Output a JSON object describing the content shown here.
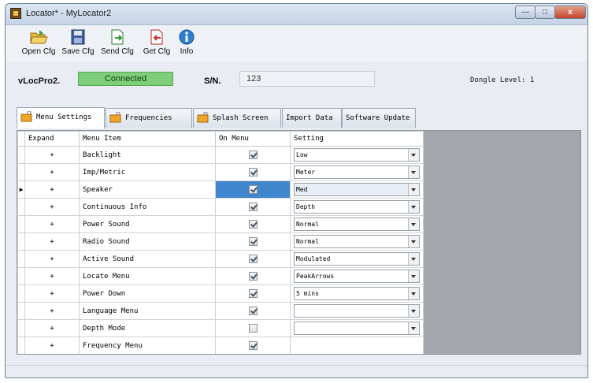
{
  "window": {
    "title": "Locator* - MyLocator2",
    "controls": [
      "minimize",
      "maximize",
      "close"
    ],
    "close_glyph": "x"
  },
  "toolbar": {
    "buttons": [
      {
        "label": "Open Cfg",
        "icon": "folder-open-icon"
      },
      {
        "label": "Save Cfg",
        "icon": "save-disk-icon"
      },
      {
        "label": "Send Cfg",
        "icon": "send-document-icon"
      },
      {
        "label": "Get Cfg",
        "icon": "get-document-icon"
      },
      {
        "label": "Info",
        "icon": "info-icon"
      }
    ]
  },
  "status": {
    "device": "vLocPro2.",
    "connection": "Connected",
    "connection_color": "#7fcf7a",
    "sn_label": "S/N.",
    "sn_value": "123",
    "dongle_level": "Dongle Level: 1"
  },
  "tabs": [
    {
      "label": "Menu Settings",
      "active": true,
      "icon": "lock-folder-icon"
    },
    {
      "label": "Frequencies",
      "active": false,
      "icon": "lock-folder-icon"
    },
    {
      "label": "Splash Screen",
      "active": false,
      "icon": "lock-folder-icon"
    },
    {
      "label": "Import Data",
      "active": false
    },
    {
      "label": "Software Update",
      "active": false
    }
  ],
  "grid": {
    "columns": [
      "Expand",
      "Menu Item",
      "On Menu",
      "Setting"
    ],
    "selection_color": "#3f86cc",
    "rows": [
      {
        "expand": "+",
        "item": "Backlight",
        "on": true,
        "setting": "Low",
        "has_dropdown": true
      },
      {
        "expand": "+",
        "item": "Imp/Metric",
        "on": true,
        "setting": "Meter",
        "has_dropdown": true
      },
      {
        "expand": "+",
        "item": "Speaker",
        "on": true,
        "setting": "Med",
        "has_dropdown": true,
        "selected": true
      },
      {
        "expand": "+",
        "item": "Continuous Info",
        "on": true,
        "setting": "Depth",
        "has_dropdown": true
      },
      {
        "expand": "+",
        "item": "Power Sound",
        "on": true,
        "setting": "Normal",
        "has_dropdown": true
      },
      {
        "expand": "+",
        "item": "Radio Sound",
        "on": true,
        "setting": "Normal",
        "has_dropdown": true
      },
      {
        "expand": "+",
        "item": "Active Sound",
        "on": true,
        "setting": "Modulated",
        "has_dropdown": true
      },
      {
        "expand": "+",
        "item": "Locate Menu",
        "on": true,
        "setting": "PeakArrows",
        "has_dropdown": true
      },
      {
        "expand": "+",
        "item": "Power Down",
        "on": true,
        "setting": "5 mins",
        "has_dropdown": true
      },
      {
        "expand": "+",
        "item": "Language Menu",
        "on": true,
        "setting": "",
        "has_dropdown": true
      },
      {
        "expand": "+",
        "item": "Depth Mode",
        "on": false,
        "setting": "",
        "has_dropdown": true
      },
      {
        "expand": "+",
        "item": "Frequency Menu",
        "on": true,
        "setting": "",
        "has_dropdown": false
      }
    ]
  }
}
